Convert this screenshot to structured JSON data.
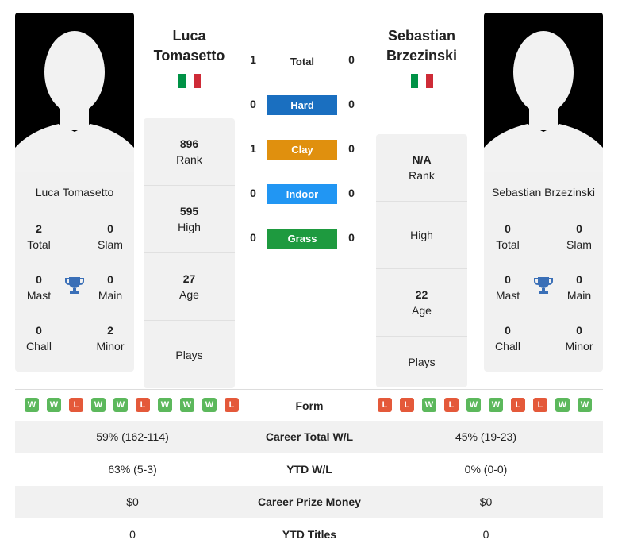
{
  "player1": {
    "name": "Luca Tomasetto",
    "title_line1": "Luca",
    "title_line2": "Tomasetto",
    "flag": "italy",
    "total": "2",
    "total_label": "Total",
    "slam": "0",
    "slam_label": "Slam",
    "mast": "0",
    "mast_label": "Mast",
    "main": "0",
    "main_label": "Main",
    "chall": "0",
    "chall_label": "Chall",
    "minor": "2",
    "minor_label": "Minor",
    "rank": "896",
    "rank_label": "Rank",
    "high": "595",
    "high_label": "High",
    "age": "27",
    "age_label": "Age",
    "plays_label": "Plays",
    "form": [
      "W",
      "W",
      "L",
      "W",
      "W",
      "L",
      "W",
      "W",
      "W",
      "L"
    ]
  },
  "player2": {
    "name": "Sebastian Brzezinski",
    "title_line1": "Sebastian",
    "title_line2": "Brzezinski",
    "flag": "italy",
    "total": "0",
    "total_label": "Total",
    "slam": "0",
    "slam_label": "Slam",
    "mast": "0",
    "mast_label": "Mast",
    "main": "0",
    "main_label": "Main",
    "chall": "0",
    "chall_label": "Chall",
    "minor": "0",
    "minor_label": "Minor",
    "rank": "N/A",
    "rank_label": "Rank",
    "high_label": "High",
    "age": "22",
    "age_label": "Age",
    "plays_label": "Plays",
    "form": [
      "L",
      "L",
      "W",
      "L",
      "W",
      "W",
      "L",
      "L",
      "W",
      "W"
    ]
  },
  "h2h": {
    "total": {
      "label": "Total",
      "p1": "1",
      "p2": "0"
    },
    "surfaces": [
      {
        "label": "Hard",
        "p1": "0",
        "p2": "0",
        "color": "#1a6fc0"
      },
      {
        "label": "Clay",
        "p1": "1",
        "p2": "0",
        "color": "#e0900e"
      },
      {
        "label": "Indoor",
        "p1": "0",
        "p2": "0",
        "color": "#2196f3"
      },
      {
        "label": "Grass",
        "p1": "0",
        "p2": "0",
        "color": "#1e9a3f"
      }
    ]
  },
  "comparison": {
    "form_label": "Form",
    "rows": [
      {
        "label": "Career Total W/L",
        "p1": "59% (162-114)",
        "p2": "45% (19-23)"
      },
      {
        "label": "YTD W/L",
        "p1": "63% (5-3)",
        "p2": "0% (0-0)"
      },
      {
        "label": "Career Prize Money",
        "p1": "$0",
        "p2": "$0"
      },
      {
        "label": "YTD Titles",
        "p1": "0",
        "p2": "0"
      }
    ]
  },
  "colors": {
    "win": "#5cb85c",
    "loss": "#e4593a",
    "trophy": "#3a6fb7",
    "flag_green": "#009246",
    "flag_white": "#ffffff",
    "flag_red": "#ce2b37"
  }
}
